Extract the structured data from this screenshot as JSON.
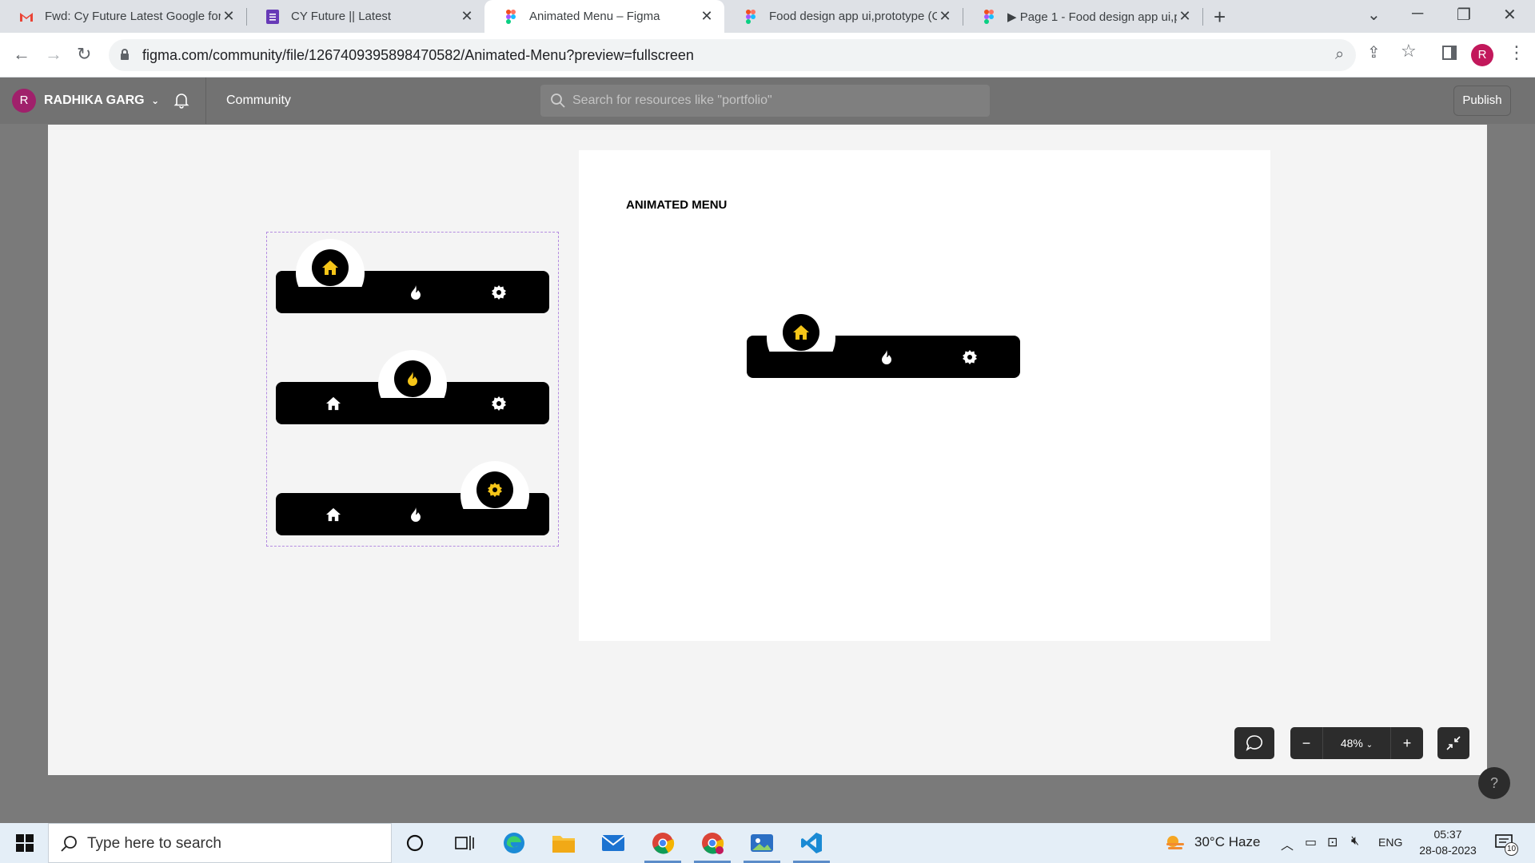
{
  "browser": {
    "tabs": [
      {
        "title": "Fwd: Cy Future Latest Google for",
        "icon": "gmail-icon",
        "active": false
      },
      {
        "title": "CY Future || Latest",
        "icon": "forms-icon",
        "active": false
      },
      {
        "title": "Animated Menu – Figma",
        "icon": "figma-icon",
        "active": true
      },
      {
        "title": "Food design app ui,prototype (C",
        "icon": "figma-icon",
        "active": false
      },
      {
        "title": "▶ Page 1 - Food design app ui,p",
        "icon": "figma-icon",
        "active": false
      }
    ],
    "url": "figma.com/community/file/1267409395898470582/Animated-Menu?preview=fullscreen",
    "profile_initial": "R"
  },
  "figma": {
    "user_initial": "R",
    "user_name": "RADHIKA GARG",
    "nav_community": "Community",
    "search_placeholder": "Search for resources like \"portfolio\"",
    "publish_label": "Publish",
    "frame_title": "ANIMATED MENU",
    "zoom": "48%",
    "help": "?"
  },
  "menu_items": [
    "home-icon",
    "fire-icon",
    "gear-icon"
  ],
  "colors": {
    "accent": "#f5c518",
    "bar": "#000000",
    "canvas": "#f4f4f4"
  },
  "taskbar": {
    "search_placeholder": "Type here to search",
    "weather": "30°C  Haze",
    "language": "ENG",
    "time": "05:37",
    "date": "28-08-2023",
    "notifications": "10"
  }
}
